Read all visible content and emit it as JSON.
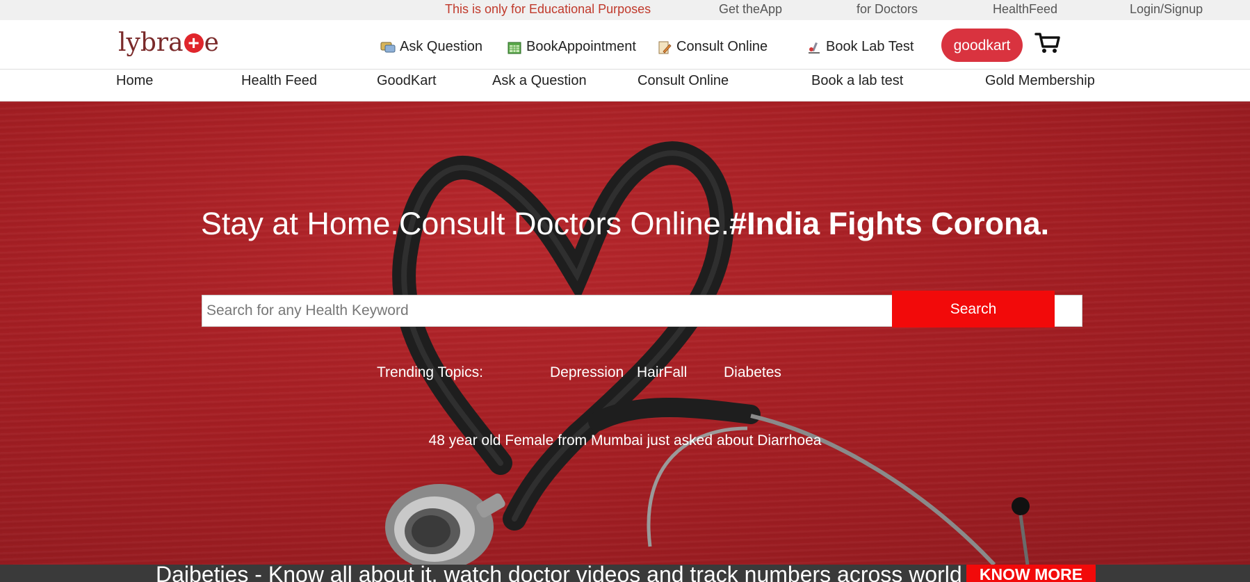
{
  "topbar": {
    "notice": "This is only for Educational Purposes",
    "get_app": "Get theApp",
    "for_doctors": "for Doctors",
    "health_feed": "HealthFeed",
    "login": "Login/Signup"
  },
  "header": {
    "logo_left": "lybra",
    "logo_right": "e",
    "nav": {
      "ask_question": "Ask Question",
      "book_appointment": "BookAppointment",
      "consult_online": "Consult Online",
      "book_lab_test": "Book Lab Test"
    },
    "goodkart_label": "goodkart",
    "icons": [
      "chat-icon",
      "calendar-icon",
      "clipboard-icon",
      "microscope-icon",
      "cart-icon"
    ]
  },
  "mainnav": {
    "home": "Home",
    "health_feed": "Health Feed",
    "goodkart": "GoodKart",
    "ask_question": "Ask a Question",
    "consult_online": "Consult Online",
    "book_lab": "Book a lab test",
    "gold": "Gold Membership"
  },
  "hero": {
    "headline_regular": "Stay at Home.Consult Doctors Online.",
    "headline_bold": "#India Fights Corona.",
    "search_placeholder": "Search for any Health Keyword",
    "search_value": "",
    "search_button": "Search",
    "trending_label": "Trending Topics:",
    "trending": [
      "Depression",
      "HairFall",
      "Diabetes"
    ],
    "asked_text": "48 year old Female from Mumbai just asked about Diarrhoea"
  },
  "banner": {
    "text": "Daibeties - Know all about it, watch doctor videos and track numbers across world",
    "button": "KNOW MORE"
  },
  "colors": {
    "brand_red": "#d9333f",
    "hero_red": "#a81f24",
    "button_red": "#f20a0a",
    "notice_red": "#c0392b",
    "banner_dark": "#3a3a3a"
  }
}
